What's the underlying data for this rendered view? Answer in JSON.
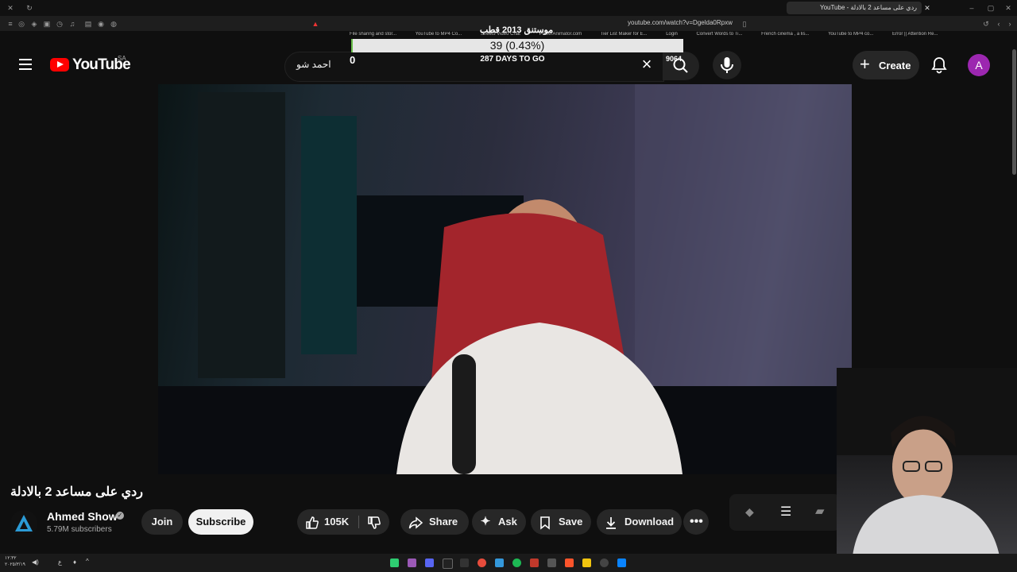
{
  "browser": {
    "tab_title": "ردي على مساعد 2 بالادلة - YouTube",
    "url": "youtube.com/watch?v=Dgelda0Rpxw",
    "bookmarks": [
      "File sharing and stor...",
      "YouTube to MP4 Co...",
      "Sheets Video Chat",
      "PowerAnimator.com",
      "Tier List Maker for E...",
      "Login",
      "Convert Words to Ti...",
      "French cinema , a lis...",
      "YouTube to MP4 co...",
      "Error || Attention Re..."
    ]
  },
  "overlay": {
    "title": "موستنق 2013 قطب",
    "progress_text": "39 (0.43%)",
    "progress_fraction": 0.0043,
    "start_value": "0",
    "days_left": "287 DAYS TO GO",
    "goal_value": "9064",
    "bar_color": "#e6e6e6",
    "fill_color": "#6abf4b"
  },
  "header": {
    "menu_icon": "hamburger-menu-icon",
    "logo_text": "YouTube",
    "country_code": "SA",
    "search_value": "احمد شو",
    "create_label": "Create",
    "avatar_letter": "A",
    "brand_color": "#ff0000",
    "avatar_color": "#9c27b0"
  },
  "video": {
    "title": "ردي على مساعد 2 بالادلة"
  },
  "channel": {
    "name": "Ahmed Show",
    "subscribers": "5.79M subscribers"
  },
  "actions": {
    "join": "Join",
    "subscribe": "Subscribe",
    "likes": "105K",
    "share": "Share",
    "ask": "Ask",
    "save": "Save",
    "download": "Download"
  },
  "taskbar": {
    "time": "١٢:٣٢",
    "date": "٢٠٢٥/٣/١٩",
    "lang": "ع"
  }
}
